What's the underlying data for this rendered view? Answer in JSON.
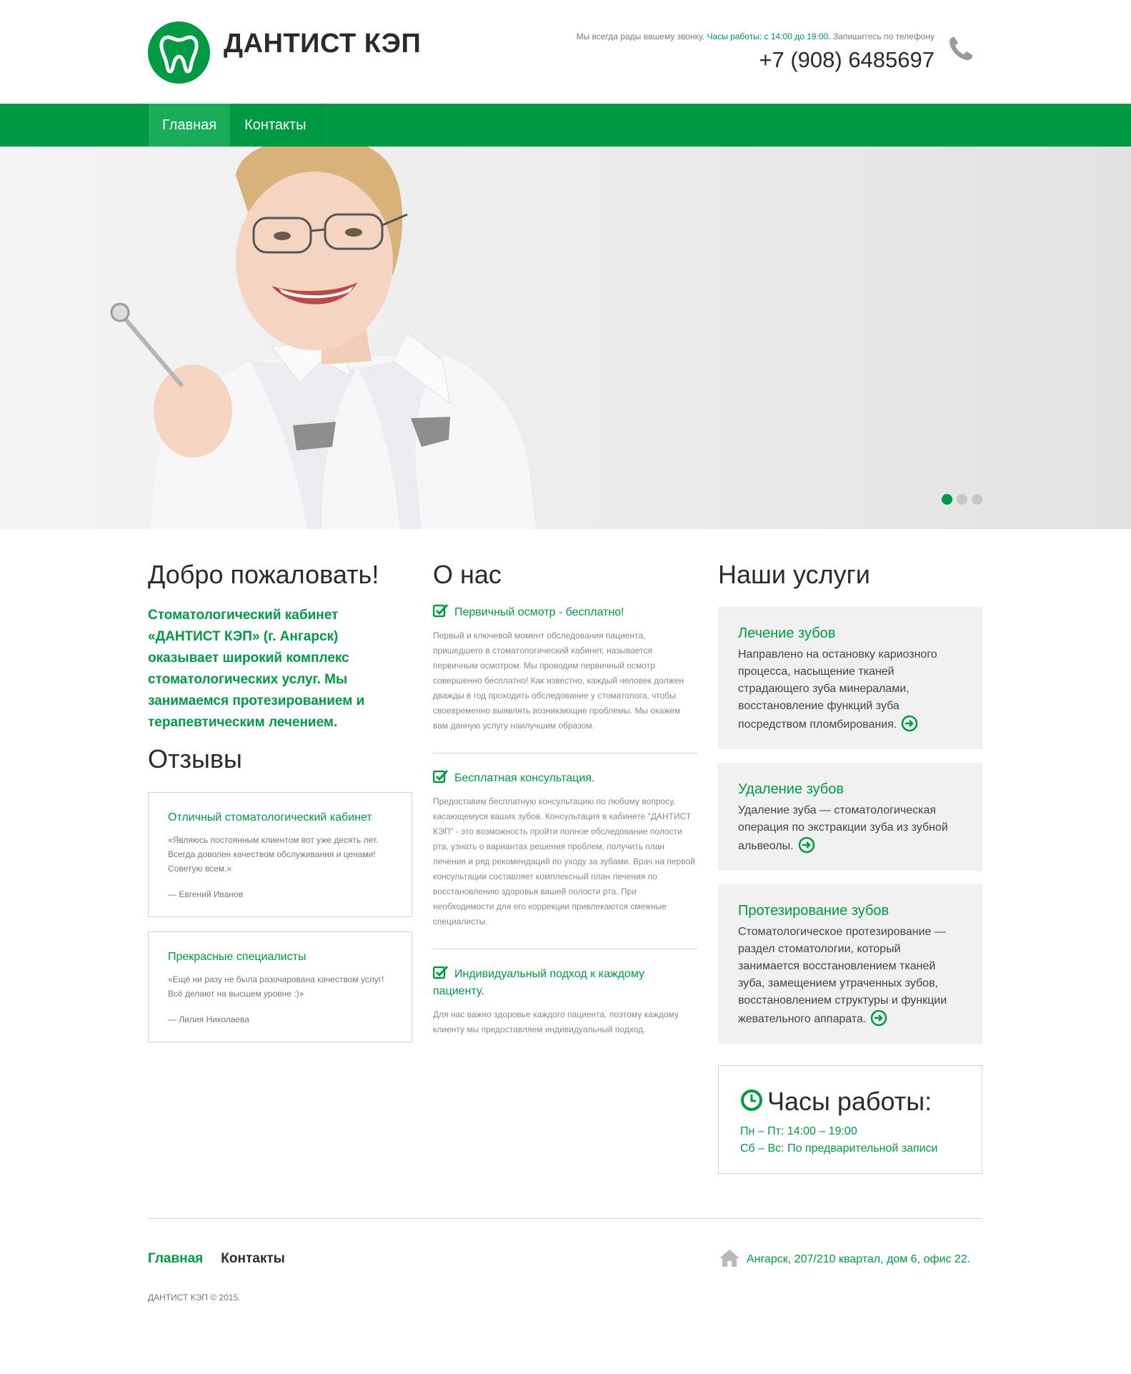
{
  "header": {
    "site_title": "ДАНТИСТ КЭП",
    "info_prefix": "Мы всегда рады вашему звонку.",
    "info_hours": "Часы работы: с 14:00 до 19:00.",
    "info_suffix": "Запишитесь по телефону",
    "phone": "+7 (908) 6485697",
    "logo_icon": "tooth-icon",
    "phone_icon": "phone-icon"
  },
  "nav": {
    "items": [
      {
        "label": "Главная",
        "active": true
      },
      {
        "label": "Контакты",
        "active": false
      }
    ]
  },
  "slider": {
    "slides": 3,
    "active_index": 0
  },
  "welcome": {
    "title": "Добро пожаловать!",
    "text": "Стоматологический кабинет «ДАНТИСТ КЭП» (г. Ангарск) оказывает широкий комплекс стоматологических услуг. Мы занимаемся протезированием и терапевтическим лечением."
  },
  "reviews": {
    "title": "Отзывы",
    "items": [
      {
        "title": "Отличный стоматологический кабинет",
        "text": "«Являюсь постоянным клиентом вот уже десять лет. Всегда доволен качеством обслуживания и ценами! Советую всем.»",
        "author": "— Евгений Иванов"
      },
      {
        "title": "Прекрасные специалисты",
        "text": "«Ещё ни разу не была разочарована качеством услуг! Всё делают на высшем уровне :)»",
        "author": "— Лилия Николаева"
      }
    ]
  },
  "about": {
    "title": "О нас",
    "items": [
      {
        "title": "Первичный осмотр - бесплатно!",
        "text": "Первый и ключевой момент обследования пациента, пришедшего в стоматологический кабинет, называется первичным осмотром. Мы проводим первичный осмотр совершенно бесплатно! Как известно, каждый человек должен дважды в год проходить обследование у стоматолога, чтобы своевременно выявлять возникающие проблемы. Мы окажем вам данную услугу наилучшим образом."
      },
      {
        "title": "Бесплатная консультация.",
        "text": "Предоставим бесплатную консультацию по любому вопросу, касающемуся ваших зубов. Консультация в кабинете \"ДАНТИСТ КЭП\" - это возможность пройти полное обследование полости рта, узнать о вариантах решения проблем, получить план лечения и ряд рекомендаций по уходу за зубами. Врач на первой консультации составляет комплексный план лечения по восстановлению здоровья вашей полости рта. При необходимости для его коррекции привлекаются смежные специалисты."
      },
      {
        "title": "Индивидуальный подход к каждому пациенту.",
        "text": "Для нас важно здоровье каждого пациента, поэтому каждому клиенту мы предоставляем индивидуальный подход."
      }
    ]
  },
  "services": {
    "title": "Наши услуги",
    "items": [
      {
        "title": "Лечение зубов",
        "text": "Направлено на остановку кариозного процесса, насыщение тканей страдающего зуба минералами, восстановление функций зуба посредством пломбирования."
      },
      {
        "title": "Удаление зубов",
        "text": "Удаление зуба — стоматологическая операция по экстракции зуба из зубной альвеолы."
      },
      {
        "title": "Протезирование зубов",
        "text": "Стоматологическое протезирование — раздел стоматологии, который занимается восстановлением тканей зуба, замещением утраченных зубов, восстановлением структуры и функции жевательного аппарата."
      }
    ]
  },
  "hours": {
    "title": "Часы работы:",
    "weekdays": "Пн – Пт: 14:00 – 19:00",
    "weekend": "Сб – Вс: По предварительной записи"
  },
  "footer": {
    "nav": [
      "Главная",
      "Контакты"
    ],
    "copyright": "ДАНТИСТ КЭП © 2015.",
    "address": "Ангарск, 207/210 квартал, дом 6, офис 22."
  },
  "colors": {
    "brand_green": "#009a44",
    "text_dark": "#2b2b2b",
    "service_bg": "#f0f0f0"
  }
}
